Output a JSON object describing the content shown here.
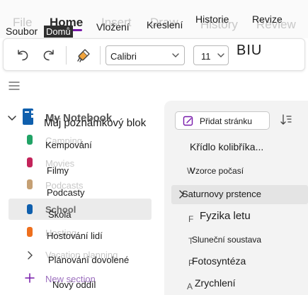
{
  "ribbon": {
    "tabs_ghost": [
      "File",
      "Home",
      "Insert",
      "Draw",
      "History",
      "Review"
    ],
    "labels": {
      "file": "Soubor",
      "home": "Domů",
      "insert": "Vložení",
      "draw": "Kreslení",
      "history": "Historie",
      "review": "Revize"
    },
    "selected_tab": "home",
    "accent": "#7719aa"
  },
  "toolbar": {
    "font_name": "Calibri",
    "font_size": "11",
    "bold_italic_underline": "BIU",
    "icons": [
      "undo-icon",
      "redo-icon",
      "format-painter-icon"
    ]
  },
  "notebook": {
    "name_ghost": "My Notebook",
    "name": "Můj poznámkový blok",
    "sections": [
      {
        "ghost": "Camping",
        "label": "Kempování",
        "color": "#21a366"
      },
      {
        "ghost": "Movies",
        "label": "Filmy",
        "color": "#c3235a"
      },
      {
        "ghost": "Podcasts",
        "label": "Podcasty",
        "color": "#c5a074"
      },
      {
        "ghost": "School",
        "label": "Škola",
        "color": "#0f5fad",
        "selected": true
      },
      {
        "ghost": "Hosting",
        "label": "Hostování lidí",
        "color": "#ee6f1d"
      },
      {
        "ghost": "Vacation planning",
        "label": "Plánování dovolené",
        "color": ""
      }
    ],
    "new_section_ghost": "New section",
    "new_section": "Nový oddíl"
  },
  "pages": {
    "add_page": "Přidat stránku",
    "items": [
      {
        "ghost": "",
        "label": "Křídlo kolibříka..."
      },
      {
        "ghost": "W",
        "label": "Vzorce počasí"
      },
      {
        "ghost": "S",
        "label": "Saturnovy prstence",
        "selected": true
      },
      {
        "ghost": "F",
        "label": "Fyzika letu"
      },
      {
        "ghost": "T",
        "label": "Sluneční soustava"
      },
      {
        "ghost": "P",
        "label": "Fotosyntéza"
      },
      {
        "ghost": "A",
        "label": "Zrychlení"
      }
    ]
  }
}
